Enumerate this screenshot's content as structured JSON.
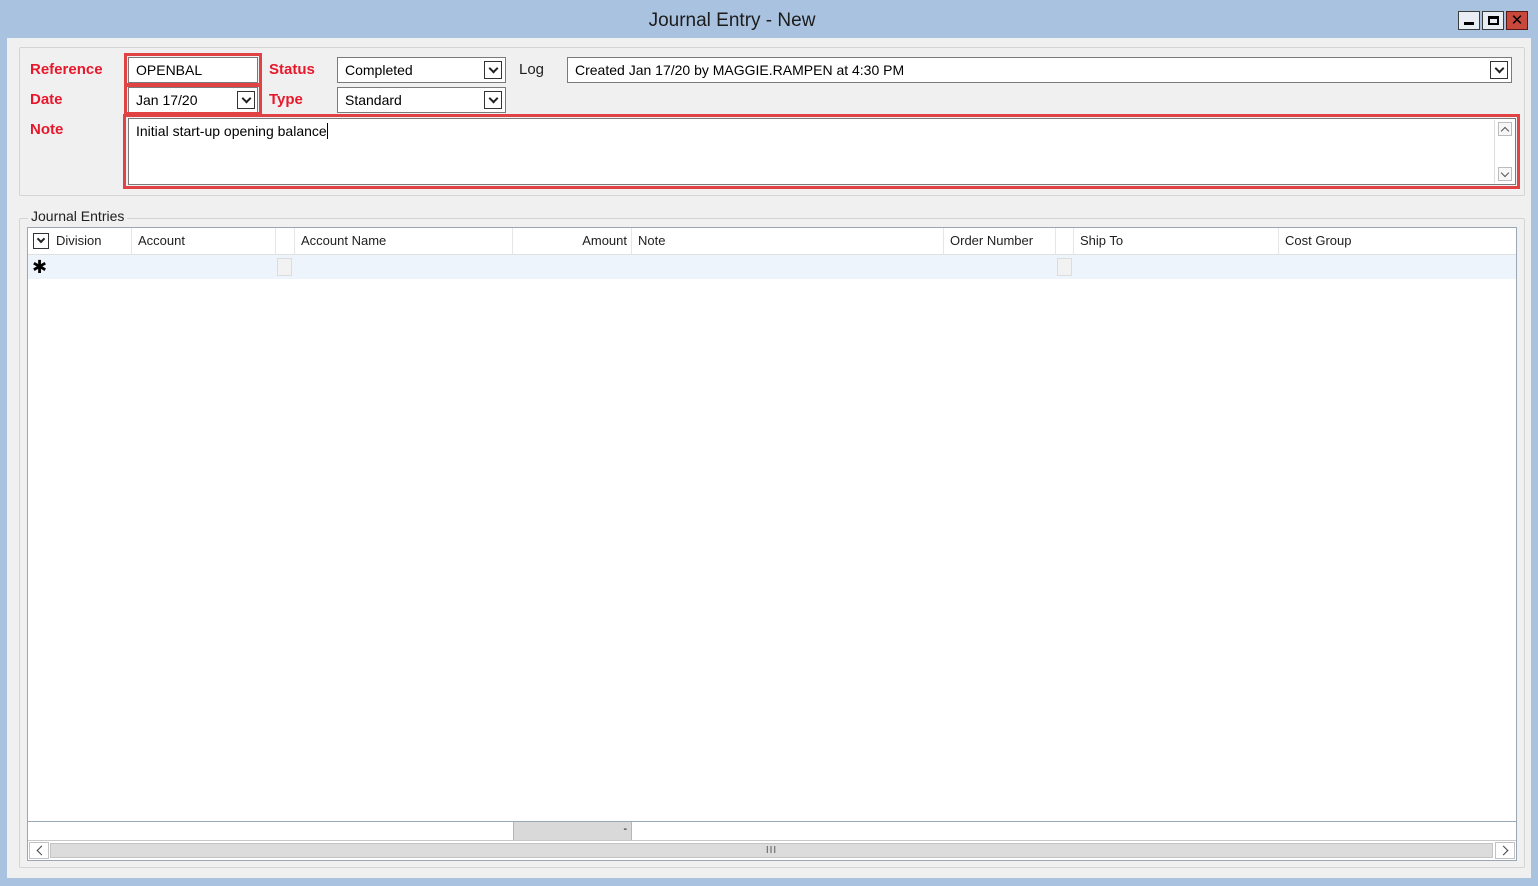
{
  "window": {
    "title": "Journal Entry - New",
    "controls": {
      "minimize": "minimize-icon",
      "maximize": "maximize-icon",
      "close": "close-icon"
    }
  },
  "form": {
    "reference": {
      "label": "Reference",
      "value": "OPENBAL"
    },
    "date": {
      "label": "Date",
      "value": "Jan 17/20"
    },
    "status": {
      "label": "Status",
      "value": "Completed"
    },
    "type": {
      "label": "Type",
      "value": "Standard"
    },
    "log": {
      "label": "Log",
      "value": "Created Jan 17/20 by MAGGIE.RAMPEN at 4:30 PM"
    },
    "note": {
      "label": "Note",
      "value": "Initial start-up opening balance"
    }
  },
  "entries": {
    "group_title": "Journal Entries",
    "columns": [
      "Division",
      "Account",
      "Account Name",
      "Amount",
      "Note",
      "Order Number",
      "Ship To",
      "Cost Group"
    ],
    "new_row_marker": "✱",
    "footer_total": "-",
    "scroll_grip": "III"
  },
  "colors": {
    "accent_label": "#e8182c",
    "highlight_box": "#e14244",
    "titlebar": "#a9c2df"
  }
}
